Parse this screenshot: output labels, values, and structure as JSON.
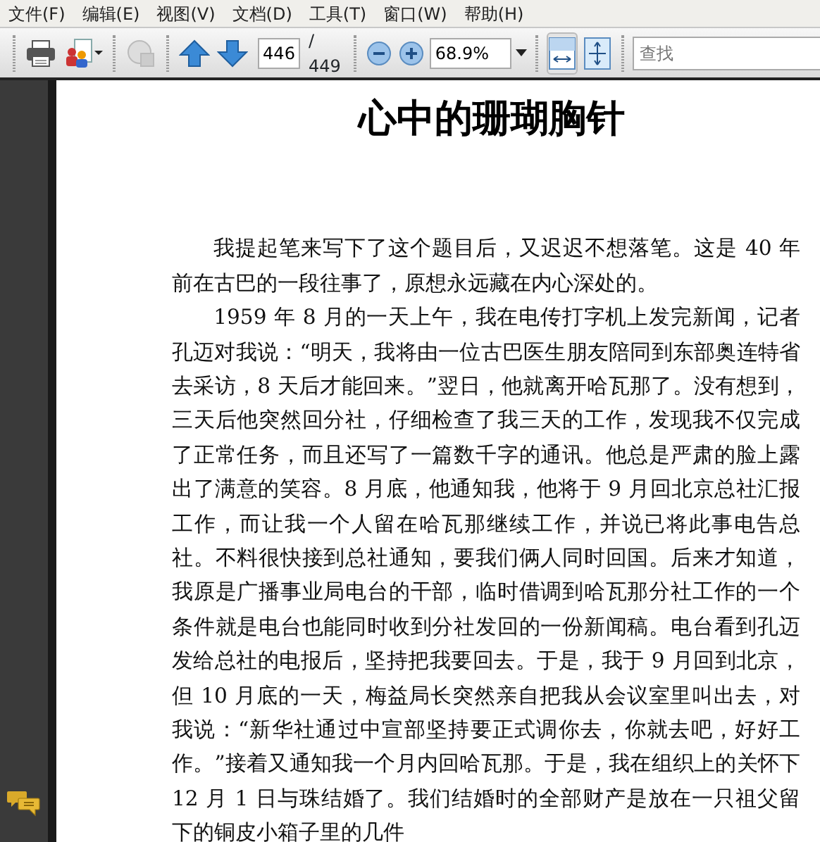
{
  "menu_bar": [
    "文件(F)",
    "编辑(E)",
    "视图(V)",
    "文档(D)",
    "工具(T)",
    "窗口(W)",
    "帮助(H)"
  ],
  "toolbar": {
    "page_number": "446",
    "page_total": "/ 449",
    "zoom": "68.9%",
    "fit_width_selected": true,
    "fit_page_selected": false,
    "search": {
      "placeholder": "查找"
    }
  },
  "document": {
    "title": "心中的珊瑚胸针",
    "paragraphs": [
      "我提起笔来写下了这个题目后，又迟迟不想落笔。这是 40 年前在古巴的一段往事了，原想永远藏在内心深处的。",
      "1959 年 8 月的一天上午，我在电传打字机上发完新闻，记者孔迈对我说：“明天，我将由一位古巴医生朋友陪同到东部奥连特省去采访，8 天后才能回来。”翌日，他就离开哈瓦那了。没有想到，三天后他突然回分社，仔细检查了我三天的工作，发现我不仅完成了正常任务，而且还写了一篇数千字的通讯。他总是严肃的脸上露出了满意的笑容。8 月底，他通知我，他将于 9 月回北京总社汇报工作，而让我一个人留在哈瓦那继续工作，并说已将此事电告总社。不料很快接到总社通知，要我们俩人同时回国。后来才知道，我原是广播事业局电台的干部，临时借调到哈瓦那分社工作的一个条件就是电台也能同时收到分社发回的一份新闻稿。电台看到孔迈发给总社的电报后，坚持把我要回去。于是，我于 9 月回到北京，但 10 月底的一天，梅益局长突然亲自把我从会议室里叫出去，对我说：“新华社通过中宣部坚持要正式调你去，你就去吧，好好工作。”接着又通知我一个月内回哈瓦那。于是，我在组织上的关怀下 12 月 1 日与珠结婚了。我们结婚时的全部财产是放在一只祖父留下的铜皮小箱子里的几件"
    ]
  }
}
